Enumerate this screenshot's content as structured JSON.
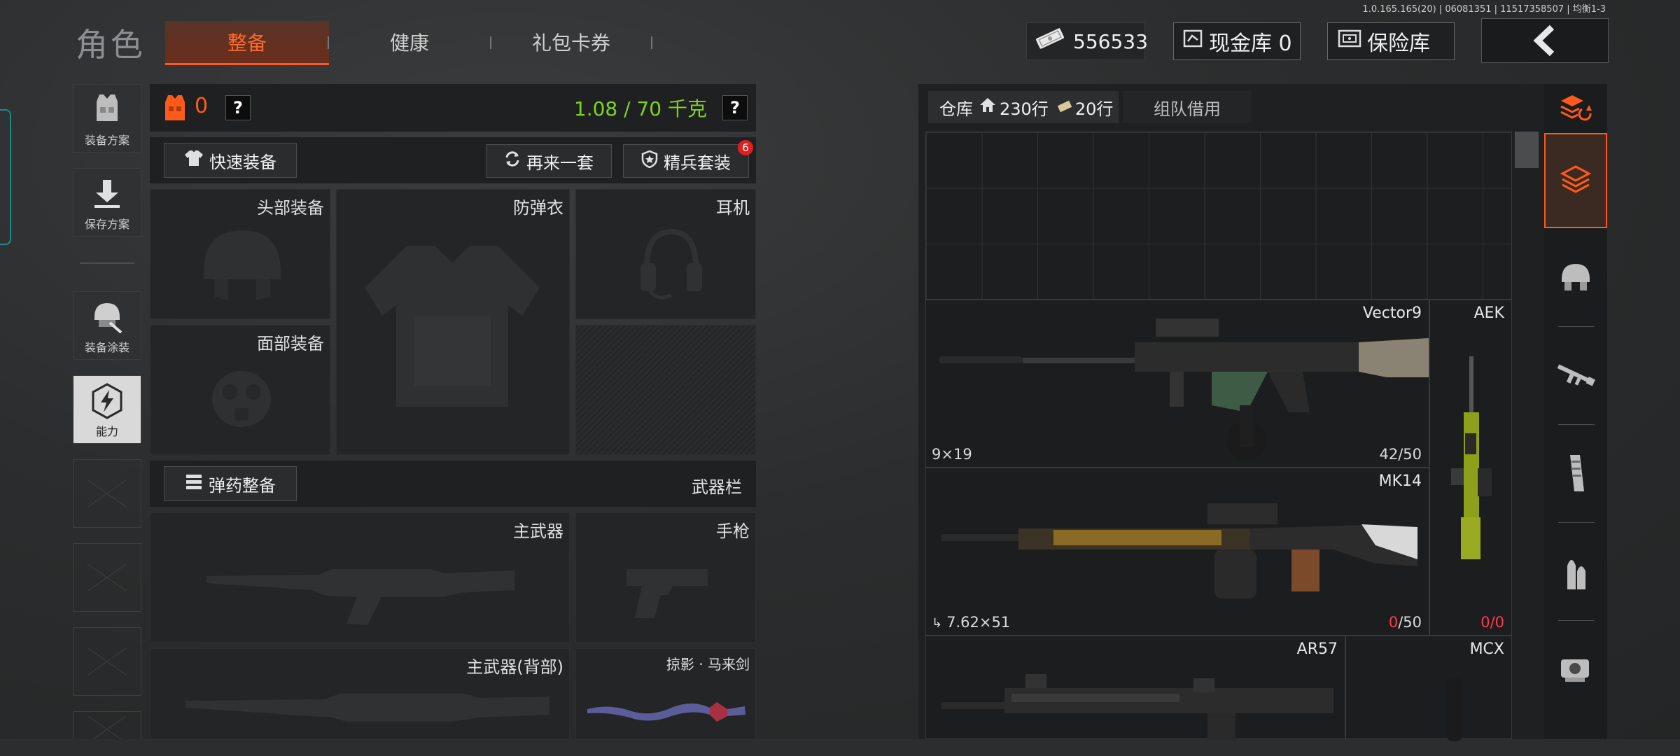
{
  "version": "1.0.165.165(20) | 06081351 | 11517358507 | 均衡1-3",
  "header": {
    "title": "角色",
    "tabs": [
      {
        "label": "整备",
        "active": true
      },
      {
        "label": "健康",
        "active": false
      },
      {
        "label": "礼包卡券",
        "active": false
      }
    ],
    "money": "556533",
    "cash_vault": "现金库 0",
    "safe_vault": "保险库"
  },
  "left_rail": {
    "items": [
      {
        "label": "装备方案",
        "icon": "vest-icon"
      },
      {
        "label": "保存方案",
        "icon": "download-icon"
      },
      {
        "label": "装备涂装",
        "icon": "helmet-paint-icon"
      },
      {
        "label": "能力",
        "icon": "lightning-icon"
      }
    ]
  },
  "loadout": {
    "armor_count": "0",
    "weight": "1.08 / 70 千克",
    "help": "?",
    "quick_equip": "快速装备",
    "reroll": "再来一套",
    "elite_set": "精兵套装",
    "elite_badge": "6",
    "slots": {
      "head": "头部装备",
      "armor": "防弹衣",
      "ear": "耳机",
      "face": "面部装备",
      "primary": "主武器",
      "pistol": "手枪",
      "primary_back": "主武器(背部)",
      "melee": "掠影 · 马来剑"
    },
    "ammo_prep": "弹药整备",
    "weapon_bar": "武器栏"
  },
  "warehouse": {
    "tab_label": "仓库",
    "rows_home": "230行",
    "rows_ticket": "20行",
    "team_borrow": "组队借用",
    "items": [
      {
        "name": "Vector9",
        "caliber": "9×19",
        "ammo": "42/50"
      },
      {
        "name": "AEK",
        "caliber": "",
        "ammo": ""
      },
      {
        "name": "MK14",
        "caliber": "7.62×51",
        "ammo_current": "0",
        "ammo_max": "/50"
      },
      {
        "name": "AEK",
        "caliber": "",
        "ammo_current": "0",
        "ammo_max": "/0"
      },
      {
        "name": "AR57",
        "caliber": "",
        "ammo": ""
      },
      {
        "name": "MCX",
        "caliber": "",
        "ammo": ""
      }
    ]
  },
  "colors": {
    "accent": "#ff5a1a",
    "weight_green": "#7ed321",
    "alert_red": "#ff3a50"
  }
}
